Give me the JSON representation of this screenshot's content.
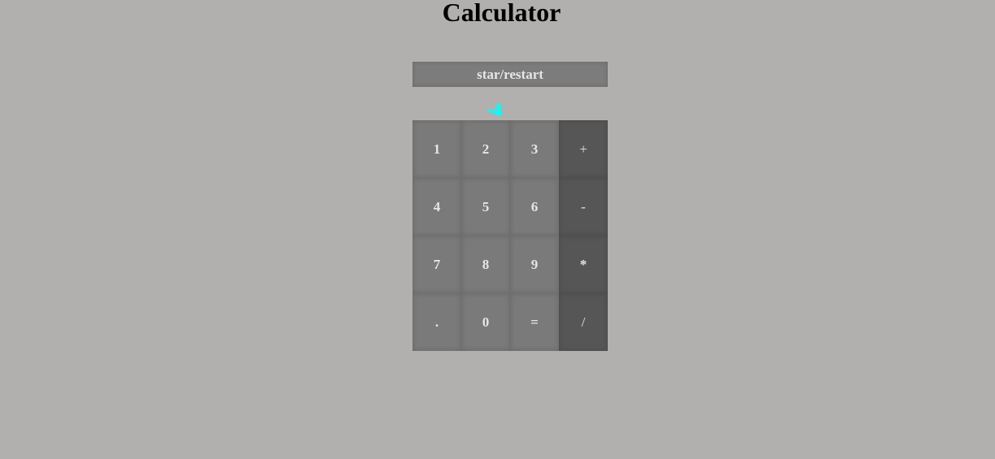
{
  "page": {
    "title": "Calculator"
  },
  "restart_button": {
    "label": "star/restart"
  },
  "display": {
    "value": "-4",
    "color": "#00ffff"
  },
  "keypad": {
    "rows": [
      [
        {
          "label": "1",
          "kind": "digit"
        },
        {
          "label": "2",
          "kind": "digit"
        },
        {
          "label": "3",
          "kind": "digit"
        },
        {
          "label": "+",
          "kind": "operator"
        }
      ],
      [
        {
          "label": "4",
          "kind": "digit"
        },
        {
          "label": "5",
          "kind": "digit"
        },
        {
          "label": "6",
          "kind": "digit"
        },
        {
          "label": "-",
          "kind": "operator"
        }
      ],
      [
        {
          "label": "7",
          "kind": "digit"
        },
        {
          "label": "8",
          "kind": "digit"
        },
        {
          "label": "9",
          "kind": "digit"
        },
        {
          "label": "*",
          "kind": "operator"
        }
      ],
      [
        {
          "label": ".",
          "kind": "digit"
        },
        {
          "label": "0",
          "kind": "digit"
        },
        {
          "label": "=",
          "kind": "digit"
        },
        {
          "label": "/",
          "kind": "operator"
        }
      ]
    ]
  },
  "colors": {
    "background": "#b1b0ae",
    "digit_key": "#7a7a7a",
    "operator_key": "#575656",
    "key_text": "#e6e6e6"
  }
}
